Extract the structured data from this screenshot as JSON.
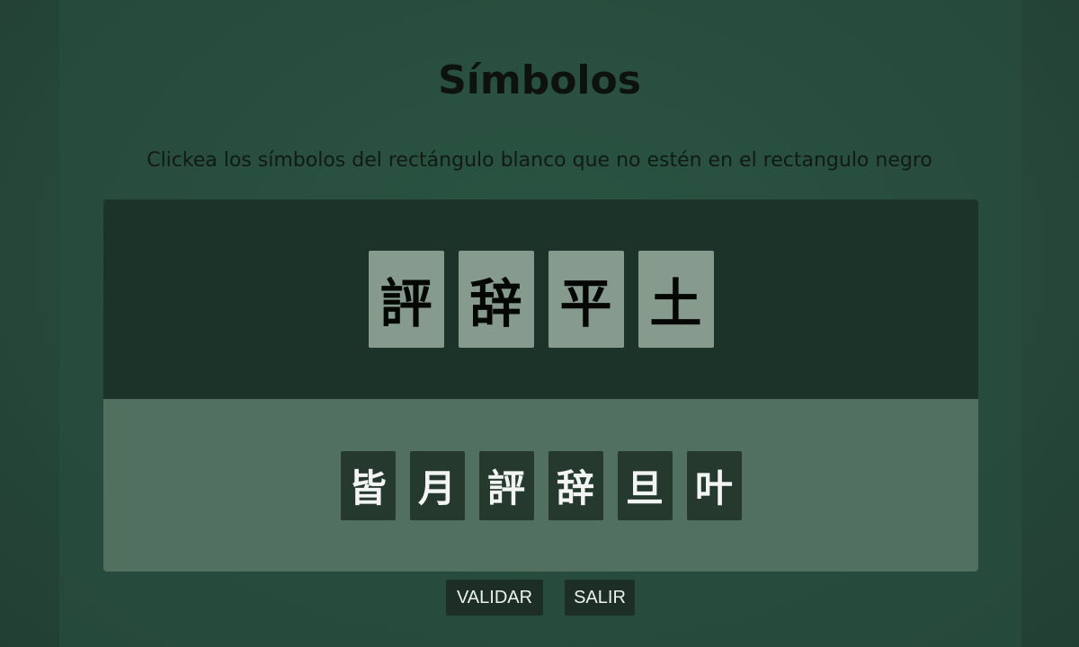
{
  "header": {
    "title": "Símbolos",
    "instructions": "Clickea los símbolos del rectángulo blanco que no estén en el rectangulo negro"
  },
  "black_rectangle": {
    "symbols": [
      "評",
      "辞",
      "平",
      "土"
    ]
  },
  "white_rectangle": {
    "symbols": [
      "皆",
      "月",
      "評",
      "辞",
      "旦",
      "叶"
    ]
  },
  "buttons": {
    "validate_label": "VALIDAR",
    "exit_label": "SALIR"
  },
  "colors": {
    "background": "#2a4d3f",
    "black_rect": "#1c3329",
    "white_rect": "#527060",
    "target_tile": "#869b8e",
    "choice_tile": "#25392f",
    "button": "#1c2e25"
  }
}
